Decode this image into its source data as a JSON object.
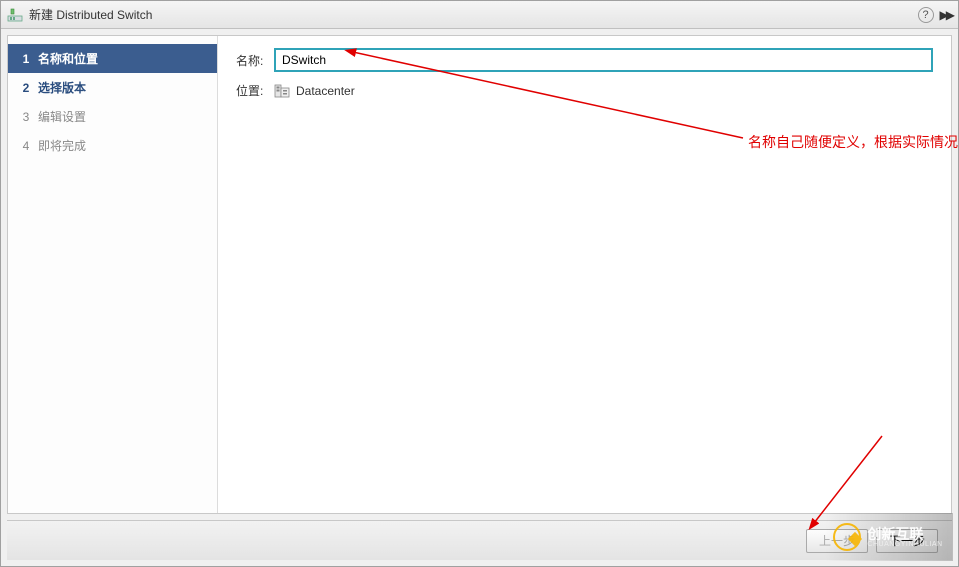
{
  "titlebar": {
    "title": "新建 Distributed Switch"
  },
  "sidebar": {
    "steps": [
      {
        "num": "1",
        "label": "名称和位置",
        "state": "active"
      },
      {
        "num": "2",
        "label": "选择版本",
        "state": "next"
      },
      {
        "num": "3",
        "label": "编辑设置",
        "state": "disabled"
      },
      {
        "num": "4",
        "label": "即将完成",
        "state": "disabled"
      }
    ]
  },
  "form": {
    "name_label": "名称:",
    "name_value": "DSwitch",
    "location_label": "位置:",
    "location_value": "Datacenter"
  },
  "annotation": {
    "text": "名称自己随便定义，根据实际情况"
  },
  "footer": {
    "back": "上一步",
    "next": "下一步"
  },
  "brand": {
    "name": "创新互联",
    "sub": "CHUANGYINHULIAN"
  }
}
